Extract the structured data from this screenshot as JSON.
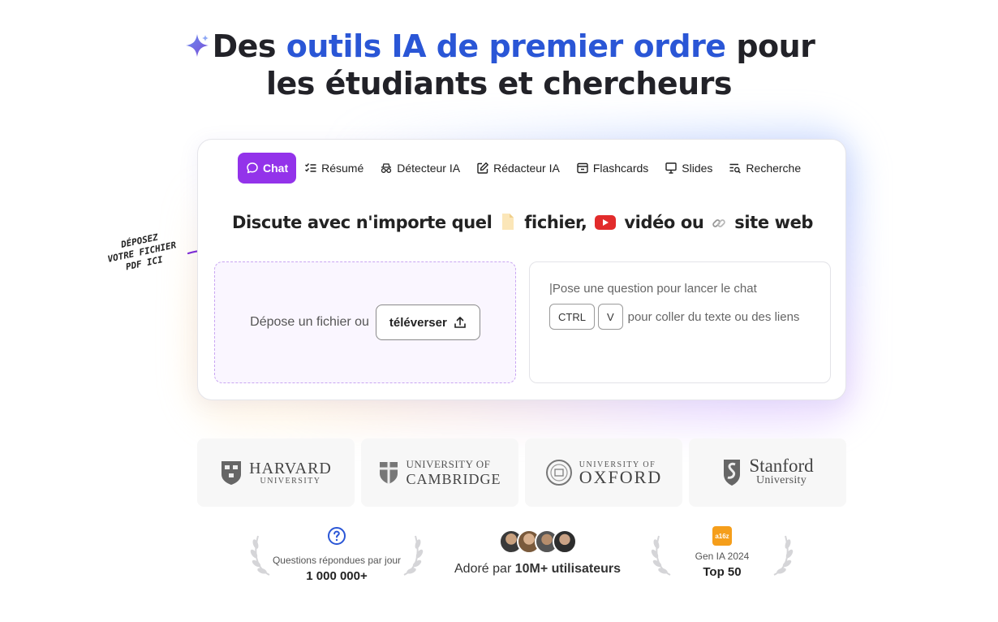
{
  "hero": {
    "title_prefix": "Des",
    "title_accent": "outils IA de premier ordre",
    "title_suffix": "pour",
    "title_line2": "les étudiants et chercheurs"
  },
  "tabs": [
    {
      "label": "Chat",
      "icon": "chat-bubble-icon",
      "active": true
    },
    {
      "label": "Résumé",
      "icon": "checklist-icon",
      "active": false
    },
    {
      "label": "Détecteur IA",
      "icon": "spy-glasses-icon",
      "active": false
    },
    {
      "label": "Rédacteur IA",
      "icon": "edit-icon",
      "active": false
    },
    {
      "label": "Flashcards",
      "icon": "card-icon",
      "active": false
    },
    {
      "label": "Slides",
      "icon": "presentation-icon",
      "active": false
    },
    {
      "label": "Recherche",
      "icon": "search-list-icon",
      "active": false
    }
  ],
  "card": {
    "heading_part1": "Discute avec n'importe quel",
    "heading_file": "fichier,",
    "heading_video": "vidéo ou",
    "heading_site": "site web"
  },
  "dropzone": {
    "text": "Dépose un fichier ou",
    "button": "téléverser"
  },
  "chat": {
    "placeholder": "|Pose une question pour lancer le chat",
    "key1": "CTRL",
    "key2": "V",
    "paste_text": "pour coller du texte ou des liens"
  },
  "handnote": {
    "line1": "DÉPOSEZ",
    "line2": "VOTRE FICHIER",
    "line3": "PDF ICI"
  },
  "logos": [
    {
      "line1": "HARVARD",
      "line2": "UNIVERSITY"
    },
    {
      "line1": "UNIVERSITY OF",
      "line2": "CAMBRIDGE"
    },
    {
      "line1": "UNIVERSITY OF",
      "line2": "OXFORD"
    },
    {
      "line1": "Stanford",
      "line2": "University"
    }
  ],
  "stats": {
    "questions_label": "Questions répondues par jour",
    "questions_value": "1 000 000+",
    "loved_prefix": "Adoré par",
    "loved_value": "10M+ utilisateurs",
    "award_badge": "a16z",
    "award_label": "Gen IA 2024",
    "award_value": "Top 50"
  },
  "colors": {
    "accent_blue": "#2a56d6",
    "tab_active": "#9333ea",
    "dropzone_border": "#c9a6f2"
  }
}
